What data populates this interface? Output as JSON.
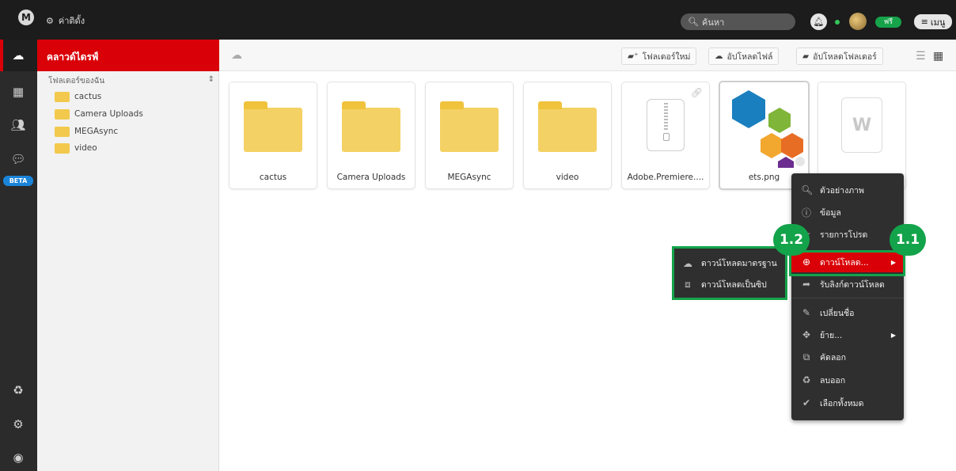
{
  "topbar": {
    "logo": "M",
    "settings_label": "ค่าติดั้ง",
    "search_placeholder": "ค้นหา",
    "plan_badge": "ฟรี",
    "menu_label": "เมนู"
  },
  "sidebar": {
    "beta_badge": "BETA"
  },
  "tree": {
    "header": "คลาวด์ไดรฟ์",
    "root_label": "โฟลเดอร์ของฉัน",
    "items": [
      {
        "label": "cactus"
      },
      {
        "label": "Camera Uploads"
      },
      {
        "label": "MEGAsync"
      },
      {
        "label": "video"
      }
    ]
  },
  "toolbar": {
    "new_folder": "โฟลเดอร์ใหม่",
    "upload_file": "อัปโหลดไฟล์",
    "upload_folder": "อัปโหลดโฟลเดอร์"
  },
  "files": [
    {
      "name": "cactus",
      "type": "folder"
    },
    {
      "name": "Camera Uploads",
      "type": "folder"
    },
    {
      "name": "MEGAsync",
      "type": "folder"
    },
    {
      "name": "video",
      "type": "folder"
    },
    {
      "name": "Adobe.Premiere....",
      "type": "zip"
    },
    {
      "name": "ets.png",
      "type": "image"
    },
    {
      "name": "",
      "type": "word"
    }
  ],
  "context_menu": {
    "items": [
      {
        "label": "ตัวอย่างภาพ",
        "icon": "search-icon"
      },
      {
        "label": "ข้อมูล",
        "icon": "info-icon"
      },
      {
        "label": "รายการโปรด",
        "icon": "star-icon"
      },
      {
        "label": "ดาวน์โหลด...",
        "icon": "download-icon"
      },
      {
        "label": "รับลิงก์ดาวน์โหลด",
        "icon": "link-icon"
      },
      {
        "label": "เปลี่ยนชื่อ",
        "icon": "pencil-icon"
      },
      {
        "label": "ย้าย...",
        "icon": "move-icon"
      },
      {
        "label": "คัดลอก",
        "icon": "copy-icon"
      },
      {
        "label": "ลบออก",
        "icon": "trash-icon"
      },
      {
        "label": "เลือกทั้งหมด",
        "icon": "check-icon"
      }
    ]
  },
  "download_submenu": {
    "items": [
      {
        "label": "ดาวน์โหลดมาตรฐาน",
        "icon": "cloud-download-icon"
      },
      {
        "label": "ดาวน์โหลดเป็นซิป",
        "icon": "zip-download-icon"
      }
    ]
  },
  "steps": {
    "step_1_1": "1.1",
    "step_1_2": "1.2"
  },
  "colors": {
    "accent_red": "#d90007",
    "highlight_green": "#13a34a",
    "folder_yellow": "#f4d164"
  }
}
